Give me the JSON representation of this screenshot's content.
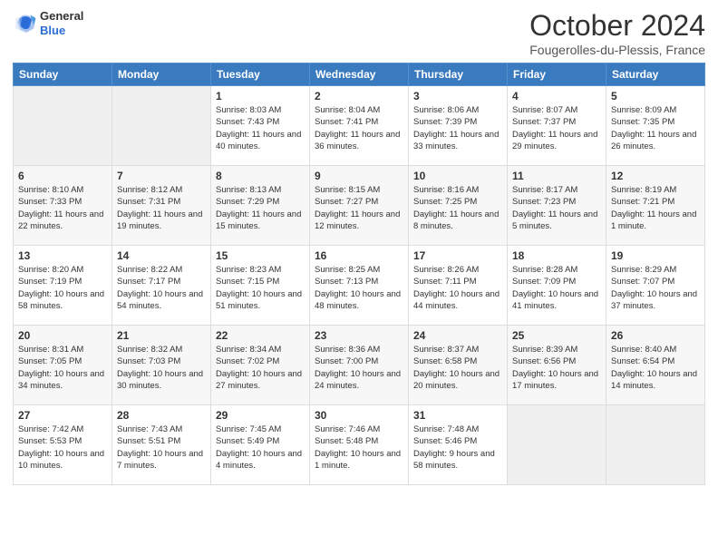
{
  "header": {
    "logo_general": "General",
    "logo_blue": "Blue",
    "month_title": "October 2024",
    "location": "Fougerolles-du-Plessis, France"
  },
  "days_of_week": [
    "Sunday",
    "Monday",
    "Tuesday",
    "Wednesday",
    "Thursday",
    "Friday",
    "Saturday"
  ],
  "weeks": [
    [
      {
        "day": "",
        "sunrise": "",
        "sunset": "",
        "daylight": ""
      },
      {
        "day": "",
        "sunrise": "",
        "sunset": "",
        "daylight": ""
      },
      {
        "day": "1",
        "sunrise": "Sunrise: 8:03 AM",
        "sunset": "Sunset: 7:43 PM",
        "daylight": "Daylight: 11 hours and 40 minutes."
      },
      {
        "day": "2",
        "sunrise": "Sunrise: 8:04 AM",
        "sunset": "Sunset: 7:41 PM",
        "daylight": "Daylight: 11 hours and 36 minutes."
      },
      {
        "day": "3",
        "sunrise": "Sunrise: 8:06 AM",
        "sunset": "Sunset: 7:39 PM",
        "daylight": "Daylight: 11 hours and 33 minutes."
      },
      {
        "day": "4",
        "sunrise": "Sunrise: 8:07 AM",
        "sunset": "Sunset: 7:37 PM",
        "daylight": "Daylight: 11 hours and 29 minutes."
      },
      {
        "day": "5",
        "sunrise": "Sunrise: 8:09 AM",
        "sunset": "Sunset: 7:35 PM",
        "daylight": "Daylight: 11 hours and 26 minutes."
      }
    ],
    [
      {
        "day": "6",
        "sunrise": "Sunrise: 8:10 AM",
        "sunset": "Sunset: 7:33 PM",
        "daylight": "Daylight: 11 hours and 22 minutes."
      },
      {
        "day": "7",
        "sunrise": "Sunrise: 8:12 AM",
        "sunset": "Sunset: 7:31 PM",
        "daylight": "Daylight: 11 hours and 19 minutes."
      },
      {
        "day": "8",
        "sunrise": "Sunrise: 8:13 AM",
        "sunset": "Sunset: 7:29 PM",
        "daylight": "Daylight: 11 hours and 15 minutes."
      },
      {
        "day": "9",
        "sunrise": "Sunrise: 8:15 AM",
        "sunset": "Sunset: 7:27 PM",
        "daylight": "Daylight: 11 hours and 12 minutes."
      },
      {
        "day": "10",
        "sunrise": "Sunrise: 8:16 AM",
        "sunset": "Sunset: 7:25 PM",
        "daylight": "Daylight: 11 hours and 8 minutes."
      },
      {
        "day": "11",
        "sunrise": "Sunrise: 8:17 AM",
        "sunset": "Sunset: 7:23 PM",
        "daylight": "Daylight: 11 hours and 5 minutes."
      },
      {
        "day": "12",
        "sunrise": "Sunrise: 8:19 AM",
        "sunset": "Sunset: 7:21 PM",
        "daylight": "Daylight: 11 hours and 1 minute."
      }
    ],
    [
      {
        "day": "13",
        "sunrise": "Sunrise: 8:20 AM",
        "sunset": "Sunset: 7:19 PM",
        "daylight": "Daylight: 10 hours and 58 minutes."
      },
      {
        "day": "14",
        "sunrise": "Sunrise: 8:22 AM",
        "sunset": "Sunset: 7:17 PM",
        "daylight": "Daylight: 10 hours and 54 minutes."
      },
      {
        "day": "15",
        "sunrise": "Sunrise: 8:23 AM",
        "sunset": "Sunset: 7:15 PM",
        "daylight": "Daylight: 10 hours and 51 minutes."
      },
      {
        "day": "16",
        "sunrise": "Sunrise: 8:25 AM",
        "sunset": "Sunset: 7:13 PM",
        "daylight": "Daylight: 10 hours and 48 minutes."
      },
      {
        "day": "17",
        "sunrise": "Sunrise: 8:26 AM",
        "sunset": "Sunset: 7:11 PM",
        "daylight": "Daylight: 10 hours and 44 minutes."
      },
      {
        "day": "18",
        "sunrise": "Sunrise: 8:28 AM",
        "sunset": "Sunset: 7:09 PM",
        "daylight": "Daylight: 10 hours and 41 minutes."
      },
      {
        "day": "19",
        "sunrise": "Sunrise: 8:29 AM",
        "sunset": "Sunset: 7:07 PM",
        "daylight": "Daylight: 10 hours and 37 minutes."
      }
    ],
    [
      {
        "day": "20",
        "sunrise": "Sunrise: 8:31 AM",
        "sunset": "Sunset: 7:05 PM",
        "daylight": "Daylight: 10 hours and 34 minutes."
      },
      {
        "day": "21",
        "sunrise": "Sunrise: 8:32 AM",
        "sunset": "Sunset: 7:03 PM",
        "daylight": "Daylight: 10 hours and 30 minutes."
      },
      {
        "day": "22",
        "sunrise": "Sunrise: 8:34 AM",
        "sunset": "Sunset: 7:02 PM",
        "daylight": "Daylight: 10 hours and 27 minutes."
      },
      {
        "day": "23",
        "sunrise": "Sunrise: 8:36 AM",
        "sunset": "Sunset: 7:00 PM",
        "daylight": "Daylight: 10 hours and 24 minutes."
      },
      {
        "day": "24",
        "sunrise": "Sunrise: 8:37 AM",
        "sunset": "Sunset: 6:58 PM",
        "daylight": "Daylight: 10 hours and 20 minutes."
      },
      {
        "day": "25",
        "sunrise": "Sunrise: 8:39 AM",
        "sunset": "Sunset: 6:56 PM",
        "daylight": "Daylight: 10 hours and 17 minutes."
      },
      {
        "day": "26",
        "sunrise": "Sunrise: 8:40 AM",
        "sunset": "Sunset: 6:54 PM",
        "daylight": "Daylight: 10 hours and 14 minutes."
      }
    ],
    [
      {
        "day": "27",
        "sunrise": "Sunrise: 7:42 AM",
        "sunset": "Sunset: 5:53 PM",
        "daylight": "Daylight: 10 hours and 10 minutes."
      },
      {
        "day": "28",
        "sunrise": "Sunrise: 7:43 AM",
        "sunset": "Sunset: 5:51 PM",
        "daylight": "Daylight: 10 hours and 7 minutes."
      },
      {
        "day": "29",
        "sunrise": "Sunrise: 7:45 AM",
        "sunset": "Sunset: 5:49 PM",
        "daylight": "Daylight: 10 hours and 4 minutes."
      },
      {
        "day": "30",
        "sunrise": "Sunrise: 7:46 AM",
        "sunset": "Sunset: 5:48 PM",
        "daylight": "Daylight: 10 hours and 1 minute."
      },
      {
        "day": "31",
        "sunrise": "Sunrise: 7:48 AM",
        "sunset": "Sunset: 5:46 PM",
        "daylight": "Daylight: 9 hours and 58 minutes."
      },
      {
        "day": "",
        "sunrise": "",
        "sunset": "",
        "daylight": ""
      },
      {
        "day": "",
        "sunrise": "",
        "sunset": "",
        "daylight": ""
      }
    ]
  ]
}
